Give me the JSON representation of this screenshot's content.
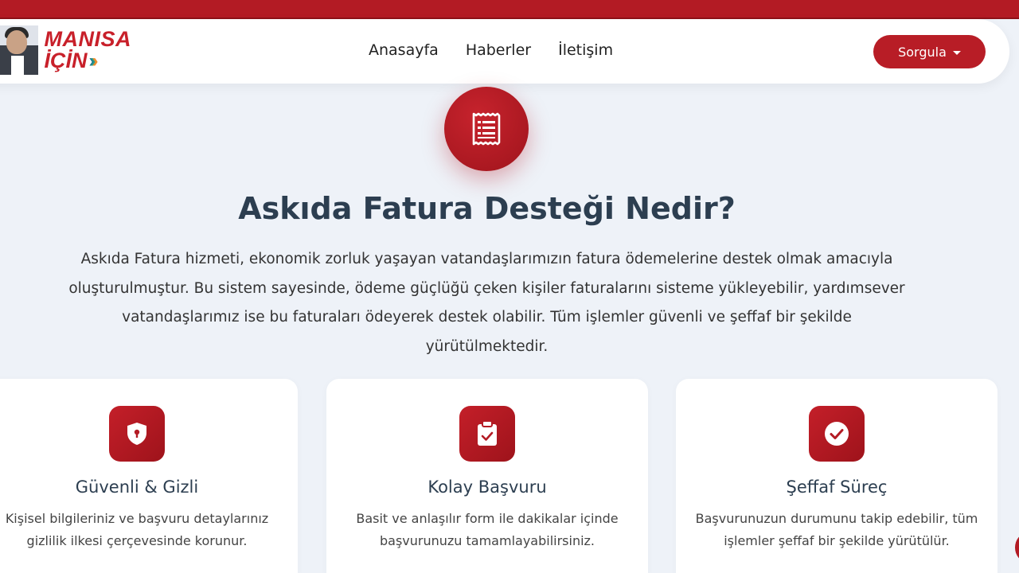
{
  "brand": {
    "line1": "MANISA",
    "line2": "İÇİN",
    "accent": "#b31b24"
  },
  "nav": {
    "links": [
      "Anasayfa",
      "Haberler",
      "İletişim"
    ],
    "dropdown_label": "Sorgula"
  },
  "hero": {
    "icon": "receipt-icon",
    "title": "Askıda Fatura Desteği Nedir?",
    "description": "Askıda Fatura hizmeti, ekonomik zorluk yaşayan vatandaşlarımızın fatura ödemelerine destek olmak amacıyla oluşturulmuştur. Bu sistem sayesinde, ödeme güçlüğü çeken kişiler faturalarını sisteme yükleyebilir, yardımsever vatandaşlarımız ise bu faturaları ödeyerek destek olabilir. Tüm işlemler güvenli ve şeffaf bir şekilde yürütülmektedir."
  },
  "features": [
    {
      "icon": "shield-lock-icon",
      "title": "Güvenli & Gizli",
      "text": "Kişisel bilgileriniz ve başvuru detaylarınız gizlilik ilkesi çerçevesinde korunur."
    },
    {
      "icon": "clipboard-check-icon",
      "title": "Kolay Başvuru",
      "text": "Basit ve anlaşılır form ile dakikalar içinde başvurunuzu tamamlayabilirsiniz."
    },
    {
      "icon": "check-circle-icon",
      "title": "Şeffaf Süreç",
      "text": "Başvurunuzun durumunu takip edebilir, tüm işlemler şeffaf bir şekilde yürütülür."
    }
  ]
}
